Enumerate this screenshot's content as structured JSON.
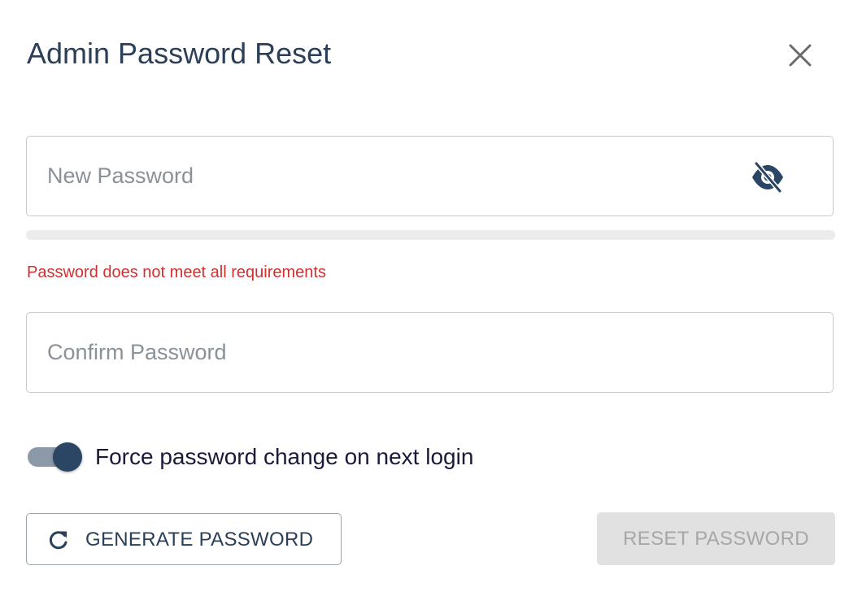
{
  "dialog": {
    "title": "Admin Password Reset"
  },
  "icons": {
    "close": "close-icon",
    "visibility": "eye-off-icon",
    "refresh": "refresh-icon"
  },
  "new_password": {
    "value": "",
    "placeholder": "New Password",
    "strength_fraction": 0
  },
  "validation": {
    "error": "Password does not meet all requirements"
  },
  "confirm_password": {
    "value": "",
    "placeholder": "Confirm Password"
  },
  "force_change": {
    "label": "Force password change on next login",
    "enabled": true
  },
  "actions": {
    "generate_label": "GENERATE PASSWORD",
    "reset_label": "RESET PASSWORD",
    "reset_enabled": false
  },
  "colors": {
    "primary": "#2b4564",
    "error": "#d32f2f",
    "disabled_bg": "#e1e1e1",
    "disabled_text": "#a7a7a7"
  }
}
